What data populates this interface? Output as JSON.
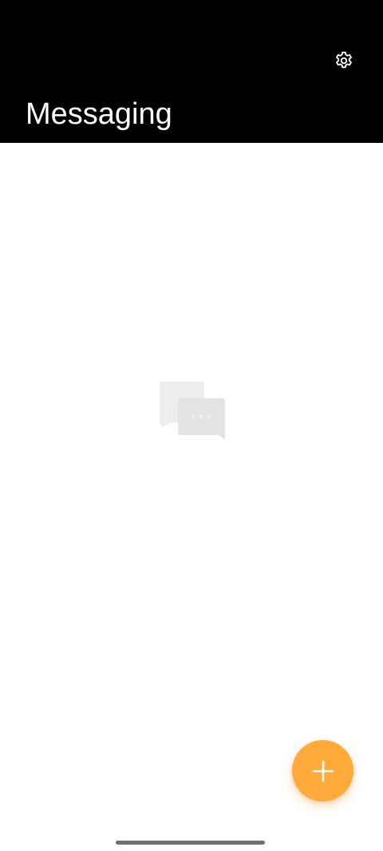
{
  "header": {
    "title": "Messaging",
    "settings_icon": "gear-icon",
    "background_color": "#000000",
    "text_color": "#ffffff"
  },
  "empty_state": {
    "icon": "chat-bubbles-icon",
    "icon_color": "#e6e6e6"
  },
  "fab": {
    "icon": "plus-icon",
    "color": "#ffaa3b"
  }
}
